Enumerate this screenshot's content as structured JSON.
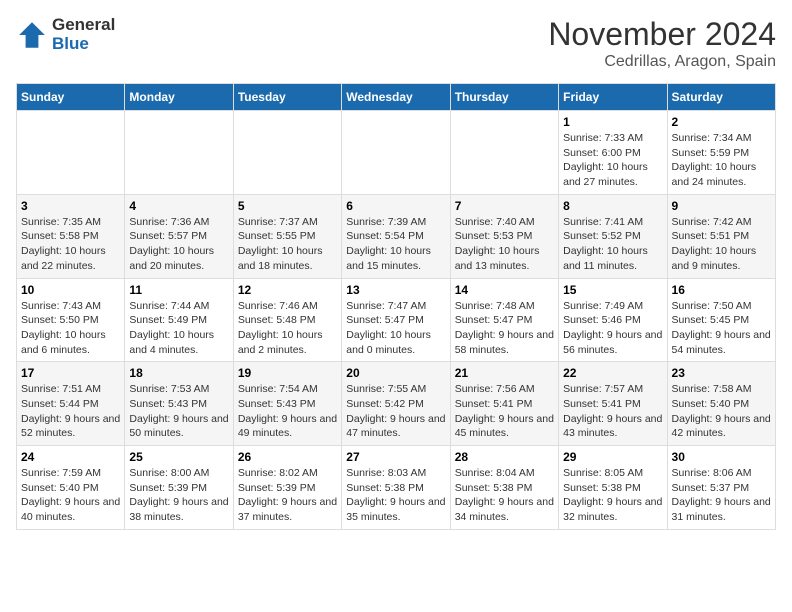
{
  "logo": {
    "general": "General",
    "blue": "Blue"
  },
  "header": {
    "month": "November 2024",
    "location": "Cedrillas, Aragon, Spain"
  },
  "days_of_week": [
    "Sunday",
    "Monday",
    "Tuesday",
    "Wednesday",
    "Thursday",
    "Friday",
    "Saturday"
  ],
  "weeks": [
    [
      {
        "day": "",
        "info": ""
      },
      {
        "day": "",
        "info": ""
      },
      {
        "day": "",
        "info": ""
      },
      {
        "day": "",
        "info": ""
      },
      {
        "day": "",
        "info": ""
      },
      {
        "day": "1",
        "info": "Sunrise: 7:33 AM\nSunset: 6:00 PM\nDaylight: 10 hours and 27 minutes."
      },
      {
        "day": "2",
        "info": "Sunrise: 7:34 AM\nSunset: 5:59 PM\nDaylight: 10 hours and 24 minutes."
      }
    ],
    [
      {
        "day": "3",
        "info": "Sunrise: 7:35 AM\nSunset: 5:58 PM\nDaylight: 10 hours and 22 minutes."
      },
      {
        "day": "4",
        "info": "Sunrise: 7:36 AM\nSunset: 5:57 PM\nDaylight: 10 hours and 20 minutes."
      },
      {
        "day": "5",
        "info": "Sunrise: 7:37 AM\nSunset: 5:55 PM\nDaylight: 10 hours and 18 minutes."
      },
      {
        "day": "6",
        "info": "Sunrise: 7:39 AM\nSunset: 5:54 PM\nDaylight: 10 hours and 15 minutes."
      },
      {
        "day": "7",
        "info": "Sunrise: 7:40 AM\nSunset: 5:53 PM\nDaylight: 10 hours and 13 minutes."
      },
      {
        "day": "8",
        "info": "Sunrise: 7:41 AM\nSunset: 5:52 PM\nDaylight: 10 hours and 11 minutes."
      },
      {
        "day": "9",
        "info": "Sunrise: 7:42 AM\nSunset: 5:51 PM\nDaylight: 10 hours and 9 minutes."
      }
    ],
    [
      {
        "day": "10",
        "info": "Sunrise: 7:43 AM\nSunset: 5:50 PM\nDaylight: 10 hours and 6 minutes."
      },
      {
        "day": "11",
        "info": "Sunrise: 7:44 AM\nSunset: 5:49 PM\nDaylight: 10 hours and 4 minutes."
      },
      {
        "day": "12",
        "info": "Sunrise: 7:46 AM\nSunset: 5:48 PM\nDaylight: 10 hours and 2 minutes."
      },
      {
        "day": "13",
        "info": "Sunrise: 7:47 AM\nSunset: 5:47 PM\nDaylight: 10 hours and 0 minutes."
      },
      {
        "day": "14",
        "info": "Sunrise: 7:48 AM\nSunset: 5:47 PM\nDaylight: 9 hours and 58 minutes."
      },
      {
        "day": "15",
        "info": "Sunrise: 7:49 AM\nSunset: 5:46 PM\nDaylight: 9 hours and 56 minutes."
      },
      {
        "day": "16",
        "info": "Sunrise: 7:50 AM\nSunset: 5:45 PM\nDaylight: 9 hours and 54 minutes."
      }
    ],
    [
      {
        "day": "17",
        "info": "Sunrise: 7:51 AM\nSunset: 5:44 PM\nDaylight: 9 hours and 52 minutes."
      },
      {
        "day": "18",
        "info": "Sunrise: 7:53 AM\nSunset: 5:43 PM\nDaylight: 9 hours and 50 minutes."
      },
      {
        "day": "19",
        "info": "Sunrise: 7:54 AM\nSunset: 5:43 PM\nDaylight: 9 hours and 49 minutes."
      },
      {
        "day": "20",
        "info": "Sunrise: 7:55 AM\nSunset: 5:42 PM\nDaylight: 9 hours and 47 minutes."
      },
      {
        "day": "21",
        "info": "Sunrise: 7:56 AM\nSunset: 5:41 PM\nDaylight: 9 hours and 45 minutes."
      },
      {
        "day": "22",
        "info": "Sunrise: 7:57 AM\nSunset: 5:41 PM\nDaylight: 9 hours and 43 minutes."
      },
      {
        "day": "23",
        "info": "Sunrise: 7:58 AM\nSunset: 5:40 PM\nDaylight: 9 hours and 42 minutes."
      }
    ],
    [
      {
        "day": "24",
        "info": "Sunrise: 7:59 AM\nSunset: 5:40 PM\nDaylight: 9 hours and 40 minutes."
      },
      {
        "day": "25",
        "info": "Sunrise: 8:00 AM\nSunset: 5:39 PM\nDaylight: 9 hours and 38 minutes."
      },
      {
        "day": "26",
        "info": "Sunrise: 8:02 AM\nSunset: 5:39 PM\nDaylight: 9 hours and 37 minutes."
      },
      {
        "day": "27",
        "info": "Sunrise: 8:03 AM\nSunset: 5:38 PM\nDaylight: 9 hours and 35 minutes."
      },
      {
        "day": "28",
        "info": "Sunrise: 8:04 AM\nSunset: 5:38 PM\nDaylight: 9 hours and 34 minutes."
      },
      {
        "day": "29",
        "info": "Sunrise: 8:05 AM\nSunset: 5:38 PM\nDaylight: 9 hours and 32 minutes."
      },
      {
        "day": "30",
        "info": "Sunrise: 8:06 AM\nSunset: 5:37 PM\nDaylight: 9 hours and 31 minutes."
      }
    ]
  ]
}
